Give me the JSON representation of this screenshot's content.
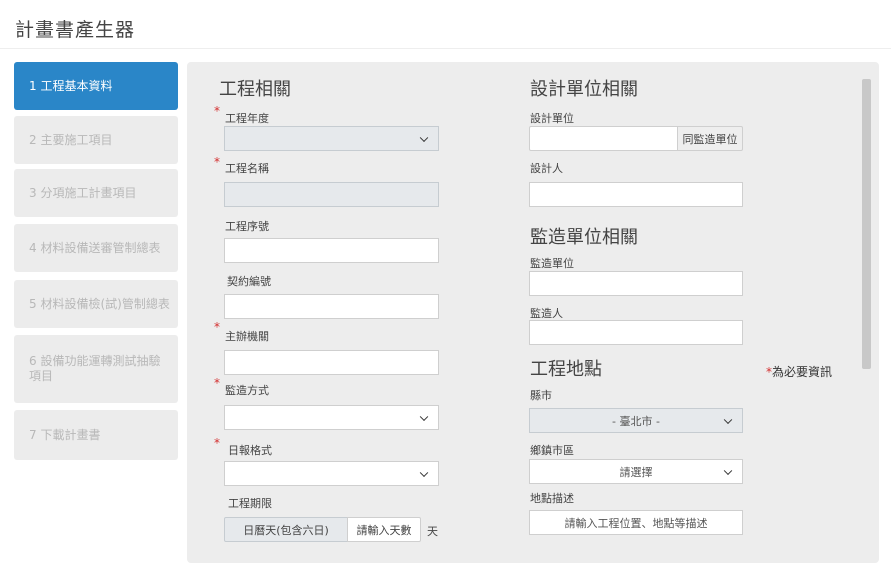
{
  "app": {
    "title": "計畫書產生器"
  },
  "steps": [
    {
      "label": "1 工程基本資料",
      "active": true
    },
    {
      "label": "2 主要施工項目",
      "active": false
    },
    {
      "label": "3 分項施工計畫項目",
      "active": false
    },
    {
      "label": "4 材料設備送審管制總表",
      "active": false
    },
    {
      "label": "5 材料設備檢(試)管制總表",
      "active": false
    },
    {
      "label": "6 設備功能運轉測試抽驗項目",
      "active": false
    },
    {
      "label": "7 下載計畫書",
      "active": false
    }
  ],
  "project": {
    "section_title": "工程相關",
    "year_label": "工程年度",
    "year_value": "",
    "name_label": "工程名稱",
    "name_value": "",
    "serial_label": "工程序號",
    "serial_value": "",
    "contract_label": "契約編號",
    "contract_value": "",
    "agency_label": "主辦機關",
    "agency_value": "",
    "supervision_method_label": "監造方式",
    "supervision_method_value": "",
    "report_format_label": "日報格式",
    "report_format_value": "",
    "period_label": "工程期限",
    "period_type": "日曆天(包含六日)",
    "period_days_button": "請輸入天數",
    "period_unit": "天"
  },
  "design": {
    "section_title": "設計單位相關",
    "unit_label": "設計單位",
    "unit_value": "",
    "same_as_supervisor_button": "同監造單位",
    "person_label": "設計人",
    "person_value": ""
  },
  "supervisor": {
    "section_title": "監造單位相關",
    "unit_label": "監造單位",
    "unit_value": "",
    "person_label": "監造人",
    "person_value": ""
  },
  "location": {
    "section_title": "工程地點",
    "county_label": "縣市",
    "county_value": "- 臺北市 -",
    "district_label": "鄉鎮市區",
    "district_value": "請選擇",
    "desc_label": "地點描述",
    "desc_placeholder": "請輸入工程位置、地點等描述"
  },
  "required_note": {
    "star": "*",
    "text": "為必要資訊"
  },
  "required_marker": "*"
}
